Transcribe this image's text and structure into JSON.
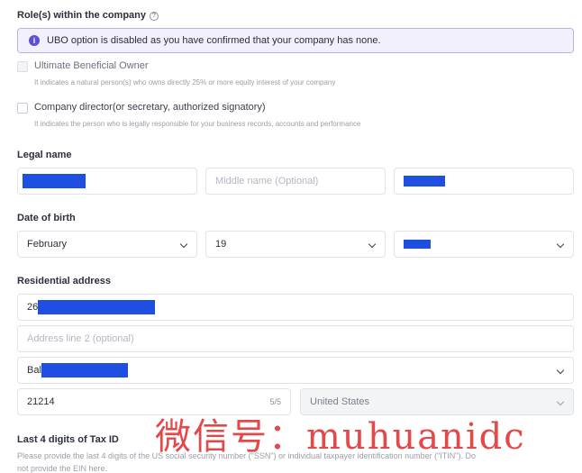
{
  "roles": {
    "label": "Role(s) within the company",
    "help_icon": "question-circle-icon",
    "notice": "UBO option is disabled as you have confirmed that your company has none.",
    "notice_icon": "info-icon",
    "options": [
      {
        "title": "Ultimate Beneficial Owner",
        "desc": "It indicates a natural person(s) who owns directly 25% or more equity interest of your company",
        "disabled": true,
        "checked": false
      },
      {
        "title": "Company director(or secretary, authorized signatory)",
        "desc": "It indicates the person who is legally responsible for your business records, accounts and performance",
        "disabled": false,
        "checked": false
      }
    ]
  },
  "legal_name": {
    "label": "Legal name",
    "first_value": "",
    "middle_placeholder": "Middle name (Optional)",
    "last_value": ""
  },
  "dob": {
    "label": "Date of birth",
    "month": "February",
    "day": "19",
    "year": ""
  },
  "address": {
    "label": "Residential address",
    "line1_prefix": "26",
    "line2_placeholder": "Address line 2 (optional)",
    "city_prefix": "Bal",
    "zip": "21214",
    "zip_counter": "5/5",
    "country": "United States"
  },
  "tax": {
    "label": "Last 4 digits of Tax ID",
    "desc_line1": "Please provide the last 4 digits of the US social security number (\"SSN\") or individual taxpayer identification number (\"ITIN\"). Do",
    "desc_line2": "not provide the EIN here."
  },
  "watermark": "微信号：muhuanidc",
  "colors": {
    "accent": "#5c4fd6",
    "redaction": "#1f4fe0",
    "watermark": "#e12828"
  }
}
